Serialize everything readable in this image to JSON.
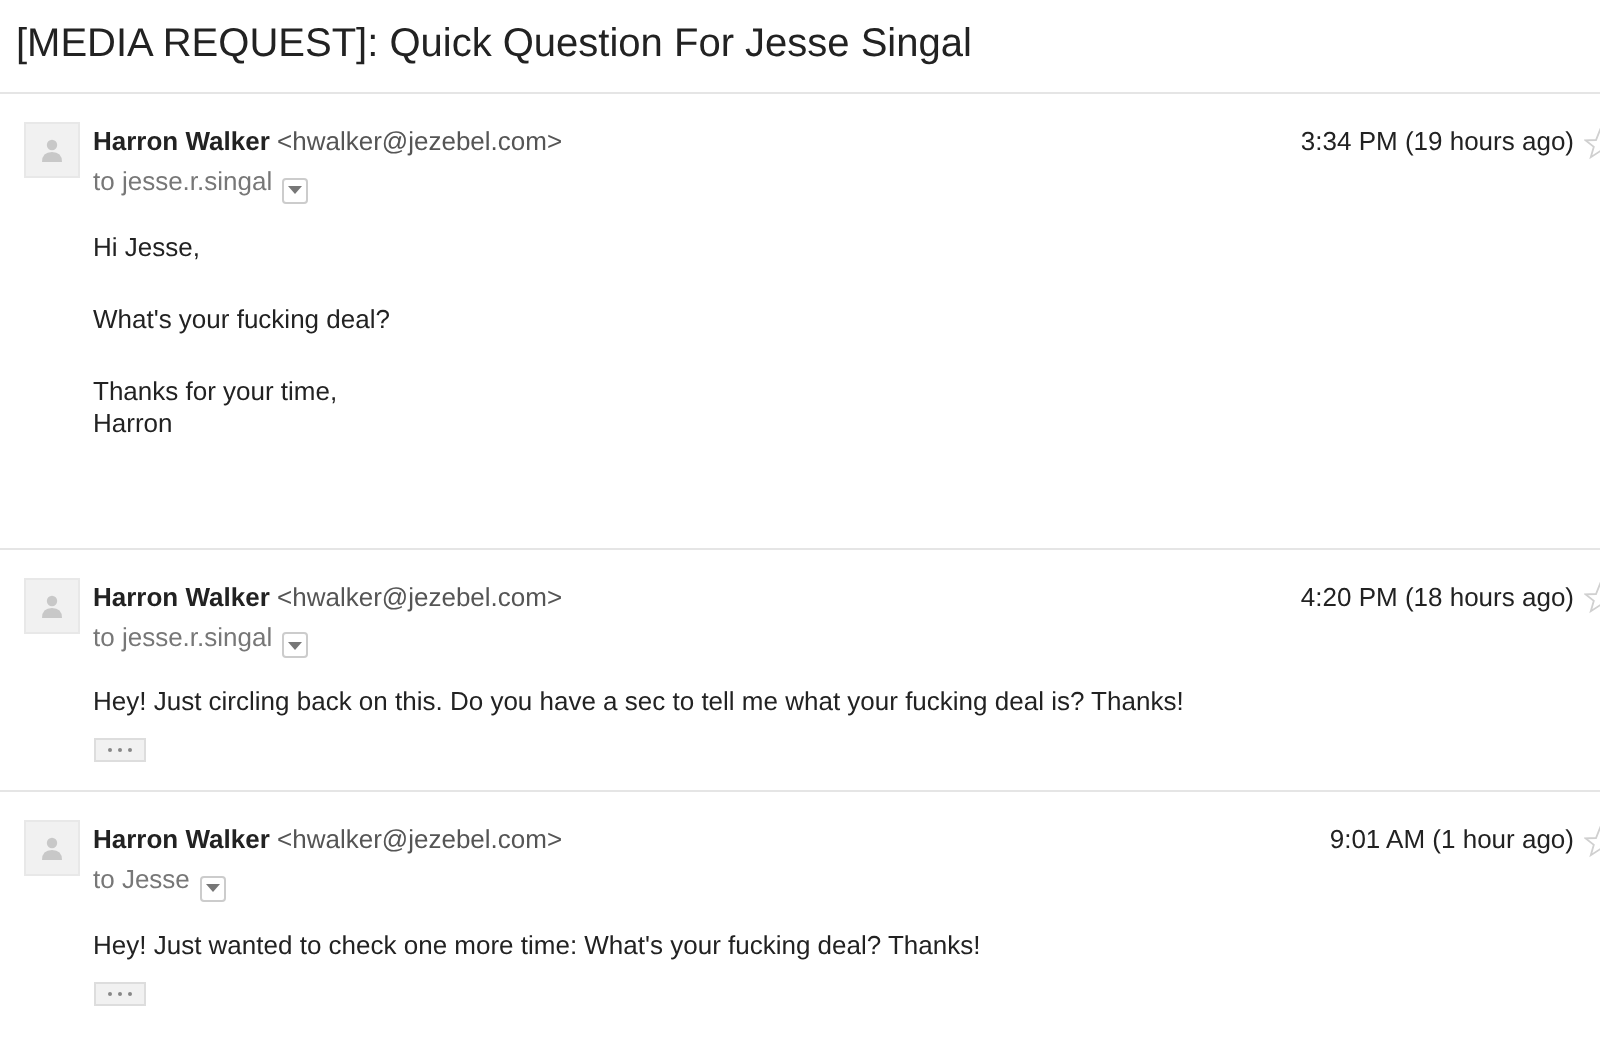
{
  "thread": {
    "subject": "[MEDIA REQUEST]: Quick Question For Jesse Singal"
  },
  "messages": [
    {
      "sender_name": "Harron Walker",
      "sender_email": "<hwalker@jezebel.com>",
      "recipient": "to jesse.r.singal",
      "time": "3:34 PM (19 hours ago)",
      "starred": false,
      "paragraphs": [
        "Hi Jesse,",
        "What's your fucking deal?",
        "Thanks for your time,\nHarron"
      ],
      "trimmed_content": false
    },
    {
      "sender_name": "Harron Walker",
      "sender_email": "<hwalker@jezebel.com>",
      "recipient": "to jesse.r.singal",
      "time": "4:20 PM (18 hours ago)",
      "starred": false,
      "paragraphs": [
        "Hey! Just circling back on this. Do you have a sec to tell me what your fucking deal is? Thanks!"
      ],
      "trimmed_content": true
    },
    {
      "sender_name": "Harron Walker",
      "sender_email": "<hwalker@jezebel.com>",
      "recipient": "to Jesse",
      "time": "9:01 AM (1 hour ago)",
      "starred": false,
      "paragraphs": [
        "Hey! Just wanted to check one more time: What's your fucking deal? Thanks!"
      ],
      "trimmed_content": true
    }
  ]
}
